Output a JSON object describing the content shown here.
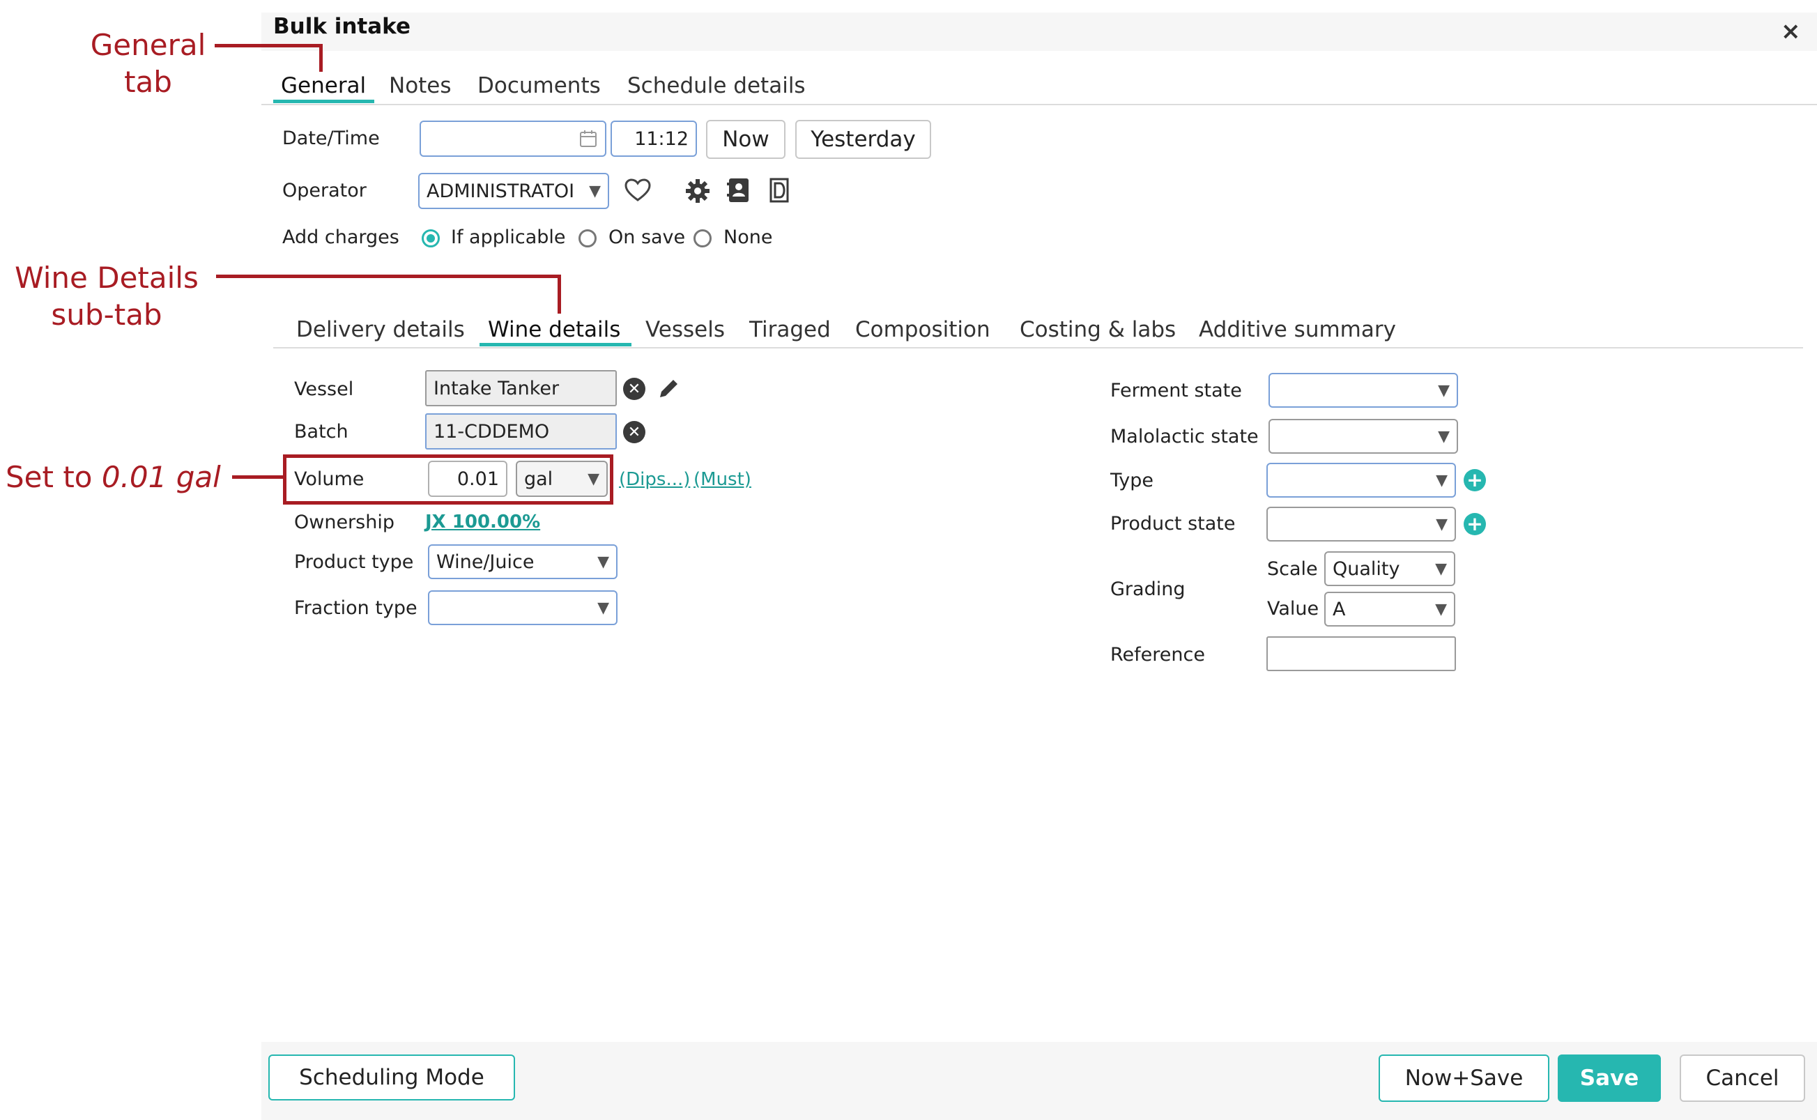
{
  "dialog": {
    "title": "Bulk intake",
    "close_glyph": "×"
  },
  "tabs": [
    "General",
    "Notes",
    "Documents",
    "Schedule details"
  ],
  "general": {
    "datetime_label": "Date/Time",
    "date_value": "",
    "time_value": "11:12",
    "now_label": "Now",
    "yesterday_label": "Yesterday",
    "operator_label": "Operator",
    "operator_value": "ADMINISTRATOI",
    "charges_label": "Add charges",
    "charges_options": [
      "If applicable",
      "On save",
      "None"
    ],
    "charges_selected": "If applicable"
  },
  "subtabs": [
    "Delivery details",
    "Wine details",
    "Vessels",
    "Tiraged",
    "Composition",
    "Costing & labs",
    "Additive summary"
  ],
  "wine": {
    "vessel_label": "Vessel",
    "vessel_value": "Intake Tanker",
    "batch_label": "Batch",
    "batch_value": "11-CDDEMO",
    "volume_label": "Volume",
    "volume_value": "0.01",
    "volume_unit": "gal",
    "dips_link": "(Dips...)",
    "must_link": "(Must)",
    "ownership_label": "Ownership",
    "ownership_link": "JX 100.00%",
    "product_type_label": "Product type",
    "product_type_value": "Wine/Juice",
    "fraction_type_label": "Fraction type",
    "fraction_type_value": "",
    "ferment_label": "Ferment state",
    "malo_label": "Malolactic state",
    "type_label": "Type",
    "product_state_label": "Product state",
    "grading_label": "Grading",
    "scale_label": "Scale",
    "scale_value": "Quality",
    "value_label": "Value",
    "value_value": "A",
    "reference_label": "Reference",
    "reference_value": ""
  },
  "footer": {
    "scheduling_label": "Scheduling Mode",
    "now_save_label": "Now+Save",
    "save_label": "Save",
    "cancel_label": "Cancel"
  },
  "annotations": {
    "general_tab_line1": "General",
    "general_tab_line2": "tab",
    "wine_tab_line1": "Wine Details",
    "wine_tab_line2": "sub-tab",
    "set_prefix": "Set to ",
    "set_value": "0.01 gal"
  },
  "colors": {
    "accent": "#26b7b0",
    "annotation": "#a81c23",
    "field_border": "#7aa0d8"
  }
}
